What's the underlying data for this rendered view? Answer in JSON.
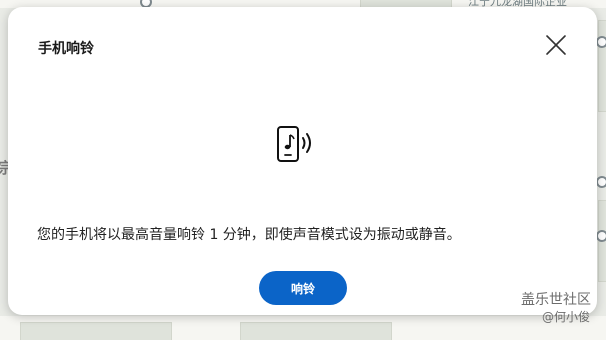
{
  "dialog": {
    "title": "手机响铃",
    "message": "您的手机将以最高音量响铃 1 分钟，即使声音模式设为振动或静音。",
    "ring_button_label": "响铃"
  },
  "map": {
    "left_label": "宗",
    "top_label": "江宁九龙湖国际企业"
  },
  "watermark": {
    "line1": "盖乐世社区",
    "line2": "@何小俊"
  },
  "colors": {
    "primary": "#0b64c8",
    "background_map": "#e9ebe6"
  }
}
